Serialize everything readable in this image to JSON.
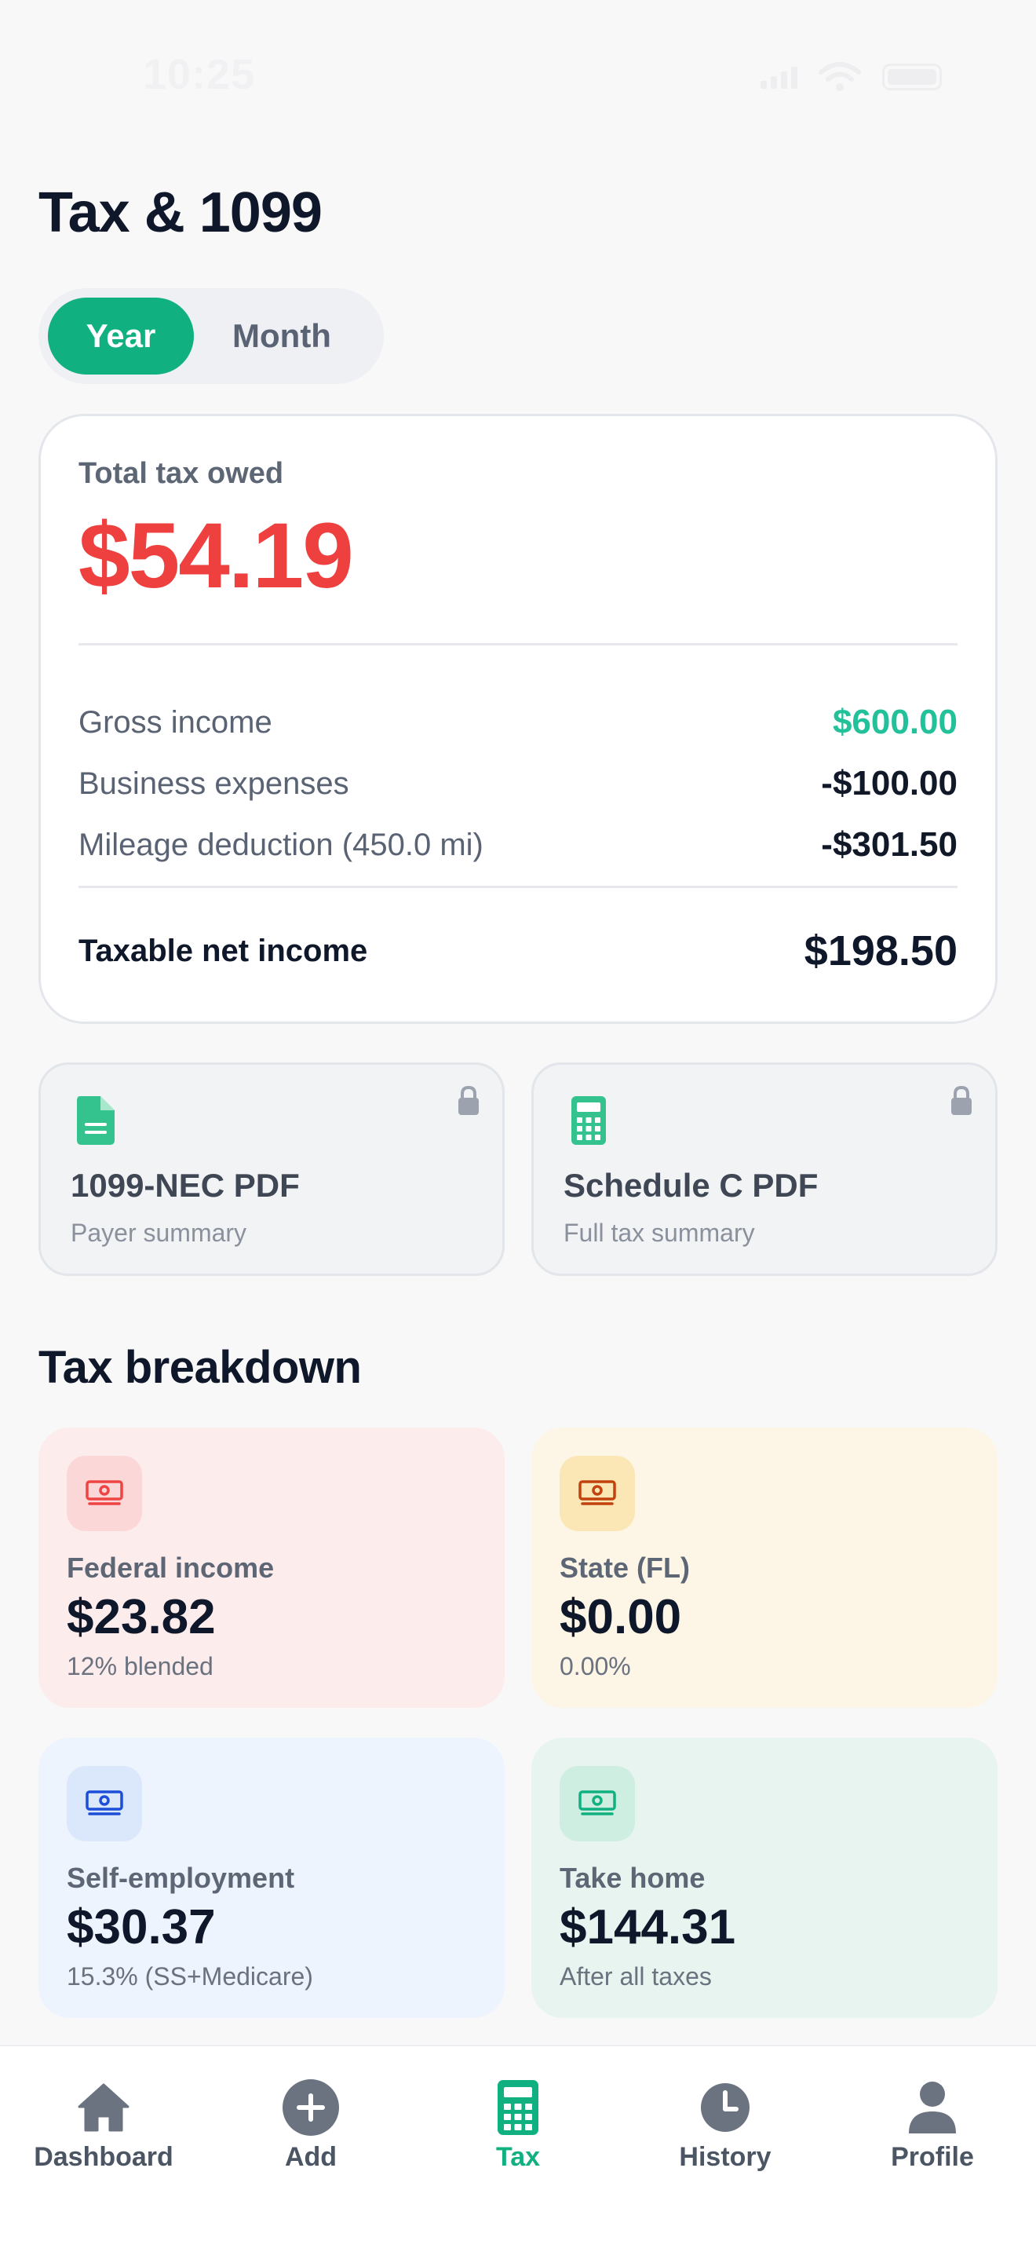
{
  "status_bar": {
    "time": "10:25"
  },
  "page_title": "Tax & 1099",
  "period_toggle": {
    "options": [
      "Year",
      "Month"
    ],
    "selected": "Year"
  },
  "summary": {
    "label": "Total tax owed",
    "total": "$54.19",
    "rows": [
      {
        "label": "Gross income",
        "value": "$600.00",
        "color": "#22c19a"
      },
      {
        "label": "Business expenses",
        "value": "-$100.00"
      },
      {
        "label": "Mileage deduction (450.0 mi)",
        "value": "-$301.50"
      }
    ],
    "net": {
      "label": "Taxable net income",
      "value": "$198.50"
    }
  },
  "pdf_cards": [
    {
      "title": "1099-NEC PDF",
      "subtitle": "Payer summary",
      "icon": "document-icon",
      "locked": true
    },
    {
      "title": "Schedule C PDF",
      "subtitle": "Full tax summary",
      "icon": "calculator-icon",
      "locked": true
    }
  ],
  "breakdown": {
    "title": "Tax breakdown",
    "tiles": [
      {
        "label": "Federal income",
        "value": "$23.82",
        "sub": "12% blended",
        "icon": "cash-icon",
        "accent": "#ef4444"
      },
      {
        "label": "State (FL)",
        "value": "$0.00",
        "sub": "0.00%",
        "icon": "cash-icon",
        "accent": "#c2410c"
      },
      {
        "label": "Self-employment",
        "value": "$30.37",
        "sub": "15.3% (SS+Medicare)",
        "icon": "cash-icon",
        "accent": "#1d4ed8"
      },
      {
        "label": "Take home",
        "value": "$144.31",
        "sub": "After all taxes",
        "icon": "cash-icon",
        "accent": "#10b080"
      }
    ]
  },
  "nav": {
    "items": [
      {
        "label": "Dashboard",
        "icon": "home-icon"
      },
      {
        "label": "Add",
        "icon": "plus-circle-icon"
      },
      {
        "label": "Tax",
        "icon": "calculator-icon",
        "active": true
      },
      {
        "label": "History",
        "icon": "clock-icon"
      },
      {
        "label": "Profile",
        "icon": "person-icon"
      }
    ]
  },
  "colors": {
    "accent": "#10b080",
    "danger": "#ef4040",
    "positive": "#22c19a"
  }
}
